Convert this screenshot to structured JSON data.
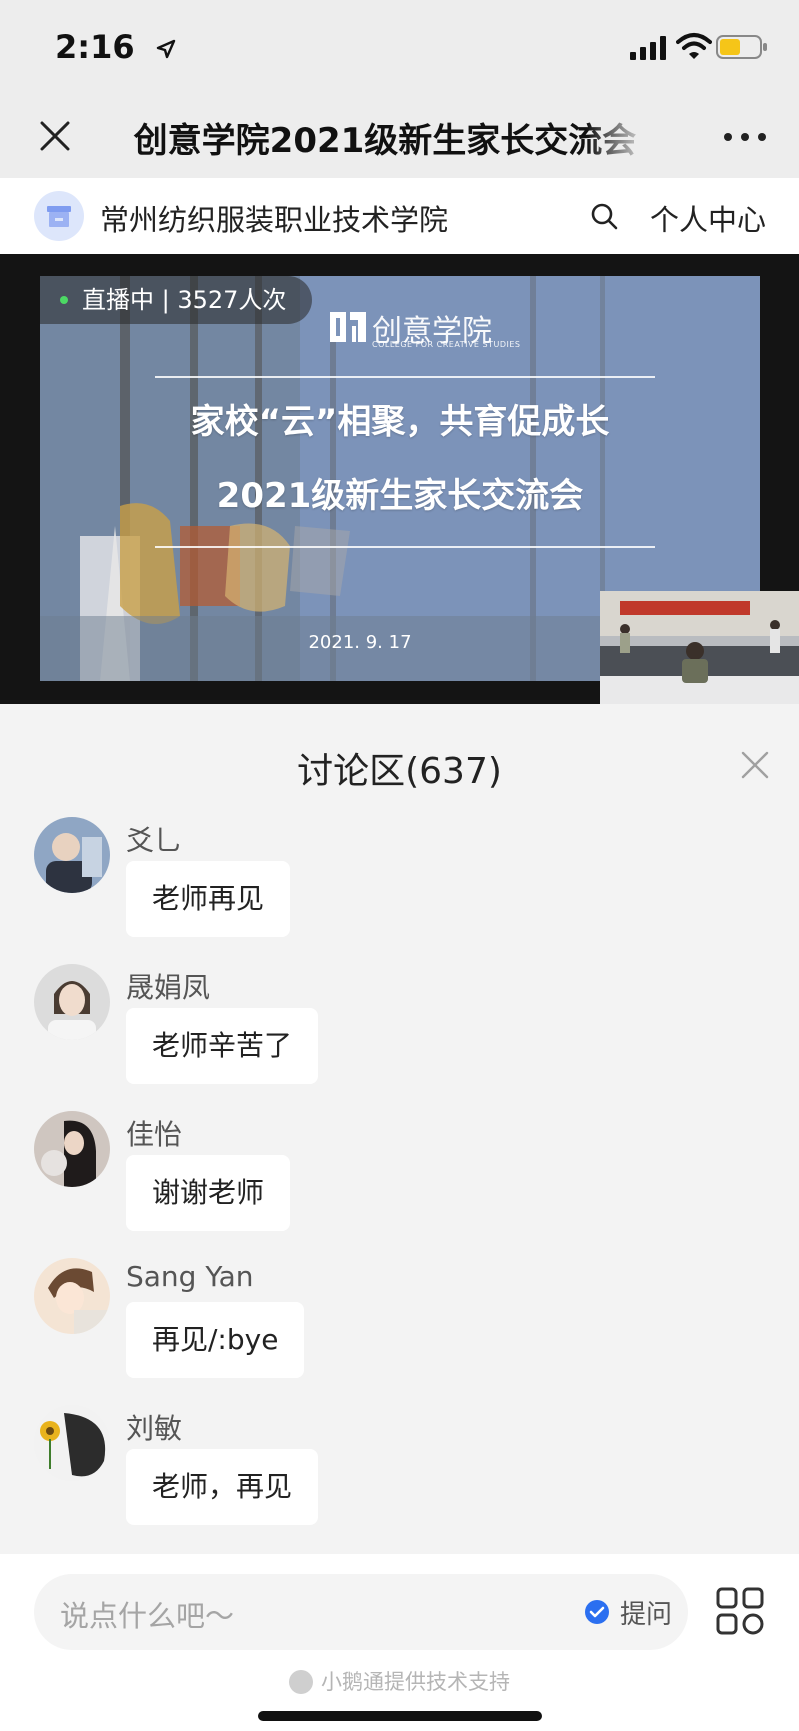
{
  "status_bar": {
    "time": "2:16"
  },
  "nav": {
    "title": "创意学院2021级新生家长交流会"
  },
  "sub_header": {
    "org_name": "常州纺织服装职业技术学院",
    "personal_center": "个人中心"
  },
  "video": {
    "live_status": "直播中 | 3527人次",
    "slide_logo": "创意学院",
    "slide_logo_sub": "COLLEGE FOR CREATIVE STUDIES",
    "slide_heading_1": "家校“云”相聚，共育促成长",
    "slide_heading_2": "2021级新生家长交流会",
    "slide_date": "2021. 9. 17"
  },
  "discussion": {
    "title": "讨论区(637)",
    "messages": [
      {
        "name": "爻乚",
        "text": "老师再见"
      },
      {
        "name": "晟娟凤",
        "text": "老师辛苦了"
      },
      {
        "name": "佳怡",
        "text": "谢谢老师"
      },
      {
        "name": "Sang Yan",
        "text": "再见/:bye"
      },
      {
        "name": "刘敏",
        "text": "老师，再见"
      }
    ]
  },
  "input": {
    "placeholder": "说点什么吧～",
    "ask_label": "提问"
  },
  "footer": {
    "support": "小鹅通提供技术支持"
  },
  "colors": {
    "accent_blue": "#2b6ff0",
    "live_green": "#4cd964"
  }
}
